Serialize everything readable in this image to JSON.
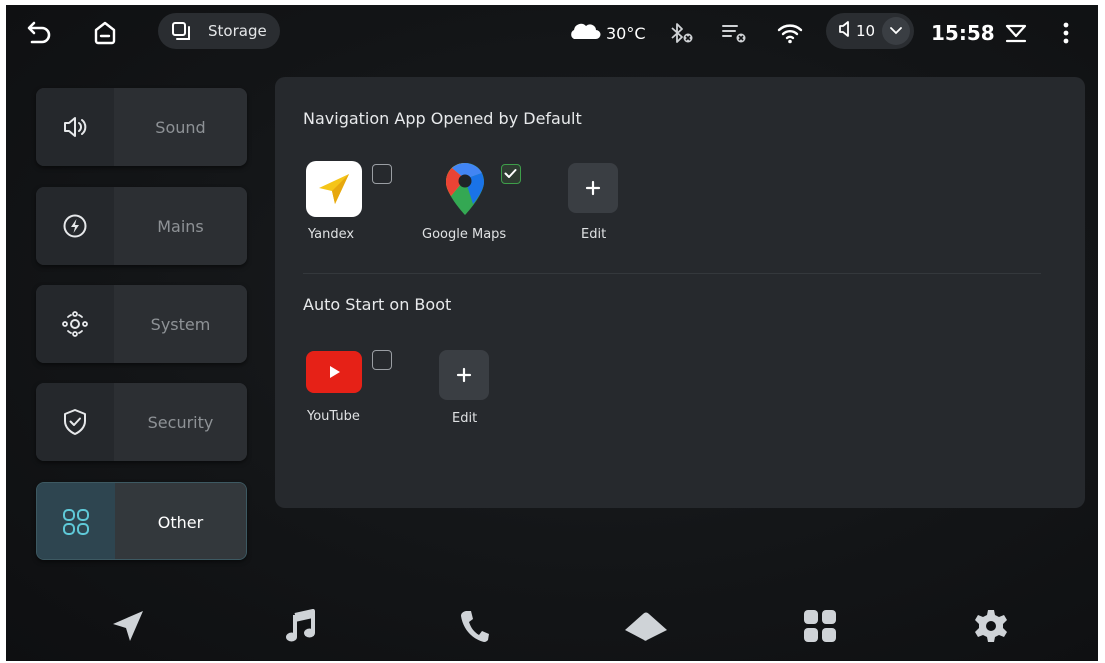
{
  "status_bar": {
    "back_icon": "back-arrow-icon",
    "home_icon": "home-icon",
    "storage_label": "Storage",
    "weather_icon": "cloud-icon",
    "temperature": "30°C",
    "bluetooth_icon": "bluetooth-off-icon",
    "playlist_icon": "playlist-off-icon",
    "wifi_icon": "wifi-icon",
    "volume_value": "10",
    "time": "15:58",
    "notification_icon": "notification-drawer-icon",
    "menu_icon": "more-vertical-icon"
  },
  "sidebar": {
    "items": [
      {
        "label": "Sound",
        "icon": "speaker-icon"
      },
      {
        "label": "Mains",
        "icon": "lightning-icon"
      },
      {
        "label": "System",
        "icon": "system-icon"
      },
      {
        "label": "Security",
        "icon": "shield-icon"
      },
      {
        "label": "Other",
        "icon": "grid-icon"
      }
    ],
    "active": "Other"
  },
  "main": {
    "nav_section": {
      "title": "Navigation App Opened by Default",
      "apps": [
        {
          "label": "Yandex",
          "checked": false
        },
        {
          "label": "Google Maps",
          "checked": true
        }
      ],
      "edit_label": "Edit"
    },
    "boot_section": {
      "title": "Auto Start on Boot",
      "apps": [
        {
          "label": "YouTube",
          "checked": false
        }
      ],
      "edit_label": "Edit"
    }
  },
  "dock": {
    "items": [
      "navigation-icon",
      "music-icon",
      "phone-icon",
      "car-icon",
      "apps-icon",
      "settings-icon"
    ]
  },
  "colors": {
    "background": "#0f1113",
    "panel": "#26292d",
    "active_accent": "#3d5962",
    "check_green": "#3e9e4a",
    "youtube_red": "#e62117"
  }
}
